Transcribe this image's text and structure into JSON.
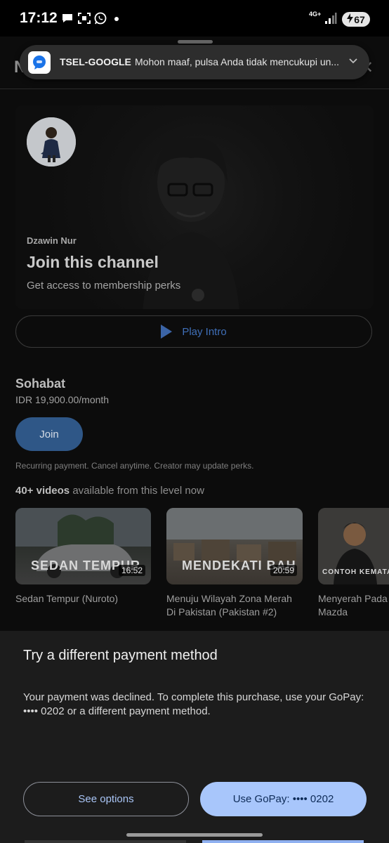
{
  "status_bar": {
    "time": "17:12",
    "network": "4G+",
    "battery": "67",
    "icons": [
      "chat-bubble-icon",
      "screen-capture-icon",
      "whatsapp-icon",
      "dot-icon",
      "signal-icon",
      "battery-charging-icon"
    ]
  },
  "notification": {
    "app": "TSEL-GOOGLE",
    "text": "Mohon maaf, pulsa Anda tidak mencukupi un...",
    "icon": "messages-icon"
  },
  "membership": {
    "channel_name": "Dzawin Nur",
    "title": "Join this channel",
    "subtitle": "Get access to membership perks",
    "play_intro": "Play Intro"
  },
  "tier": {
    "name": "Sohabat",
    "price": "IDR 19,900.00/month",
    "join_label": "Join",
    "recurring_note": "Recurring payment. Cancel anytime. Creator may update perks.",
    "videos_count": "40+ videos",
    "videos_suffix": "available from this level now"
  },
  "videos": [
    {
      "overlay": "SEDAN TEMPUR",
      "duration": "16:52",
      "title_line1": "Sedan Tempur (Nuroto)",
      "title_line2": ""
    },
    {
      "overlay": "MENDEKATI BAH",
      "duration": "20:59",
      "title_line1": "Menuju Wilayah Zona Merah",
      "title_line2": "Di Pakistan (Pakistan #2)"
    },
    {
      "overlay": "CONTOH KEMATAN",
      "duration": "",
      "title_line1": "Menyerah Pada",
      "title_line2": "Mazda"
    }
  ],
  "sheet": {
    "title": "Try a different payment method",
    "body": "Your payment was declined. To complete this purchase, use your GoPay: •••• 0202 or a different payment method.",
    "see_options": "See options",
    "use_gopay": "Use GoPay: •••• 0202"
  },
  "colors": {
    "accent_blue": "#a8c6fb",
    "sheet_bg": "#1c1c1c"
  }
}
